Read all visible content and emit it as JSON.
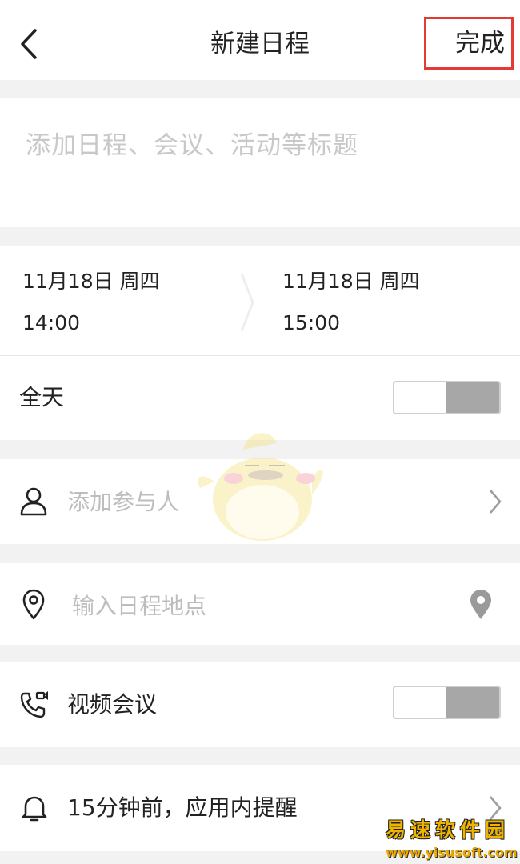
{
  "header": {
    "title": "新建日程",
    "done_label": "完成"
  },
  "title_field": {
    "placeholder": "添加日程、会议、活动等标题"
  },
  "time": {
    "start_date": "11月18日 周四",
    "start_time": "14:00",
    "end_date": "11月18日 周四",
    "end_time": "15:00"
  },
  "all_day": {
    "label": "全天",
    "enabled": false
  },
  "attendees": {
    "placeholder": "添加参与人"
  },
  "location": {
    "placeholder": "输入日程地点"
  },
  "video_meeting": {
    "label": "视频会议",
    "enabled": false
  },
  "reminder": {
    "label": "15分钟前，应用内提醒"
  },
  "watermark": {
    "brand": "易速软件园",
    "url": "www.yisusoft.com"
  },
  "colors": {
    "highlight_border": "#e53935",
    "toggle_off": "#a7a7a7",
    "placeholder": "#bdbdbd"
  }
}
